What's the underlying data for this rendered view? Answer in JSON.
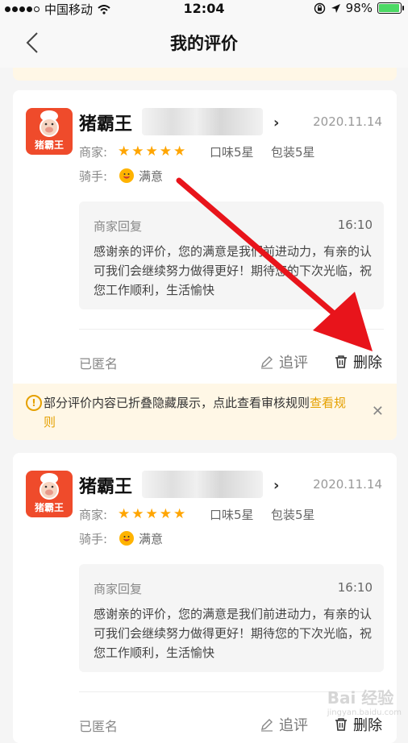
{
  "status_bar": {
    "carrier": "中国移动",
    "time": "12:04",
    "battery_percent_text": "98%",
    "battery_level": 0.98
  },
  "nav": {
    "title": "我的评价"
  },
  "reviews": [
    {
      "shop_name": "猪霸王",
      "logo_text": "猪霸王",
      "date": "2020.11.14",
      "merchant_label": "商家:",
      "rating_stars": 5,
      "taste": "口味5星",
      "packaging": "包装5星",
      "rider_label": "骑手:",
      "rider_rating": "满意",
      "reply": {
        "title": "商家回复",
        "time": "16:10",
        "text": "感谢亲的评价，您的满意是我们前进动力，有亲的认可我们会继续努力做得更好！期待您的下次光临，祝您工作顺利，生活愉快"
      },
      "anonymous": "已匿名",
      "followup": "追评",
      "delete": "删除"
    },
    {
      "shop_name": "猪霸王",
      "logo_text": "猪霸王",
      "date": "2020.11.14",
      "merchant_label": "商家:",
      "rating_stars": 5,
      "taste": "口味5星",
      "packaging": "包装5星",
      "rider_label": "骑手:",
      "rider_rating": "满意",
      "reply": {
        "title": "商家回复",
        "time": "16:10",
        "text": "感谢亲的评价，您的满意是我们前进动力，有亲的认可我们会继续努力做得更好！期待您的下次光临，祝您工作顺利，生活愉快"
      },
      "anonymous": "已匿名",
      "followup": "追评",
      "delete": "删除"
    }
  ],
  "notice": {
    "text": "部分评价内容已折叠隐藏展示，点此查看审核规则",
    "link": "查看规则"
  },
  "watermark": {
    "main": "Bai 经验",
    "sub": "jingyan.baidu.com"
  },
  "colors": {
    "accent_orange": "#ffa500",
    "notice_bg": "#fff7e6",
    "arrow_red": "#e8141b",
    "logo_red": "#ef4b2b"
  }
}
